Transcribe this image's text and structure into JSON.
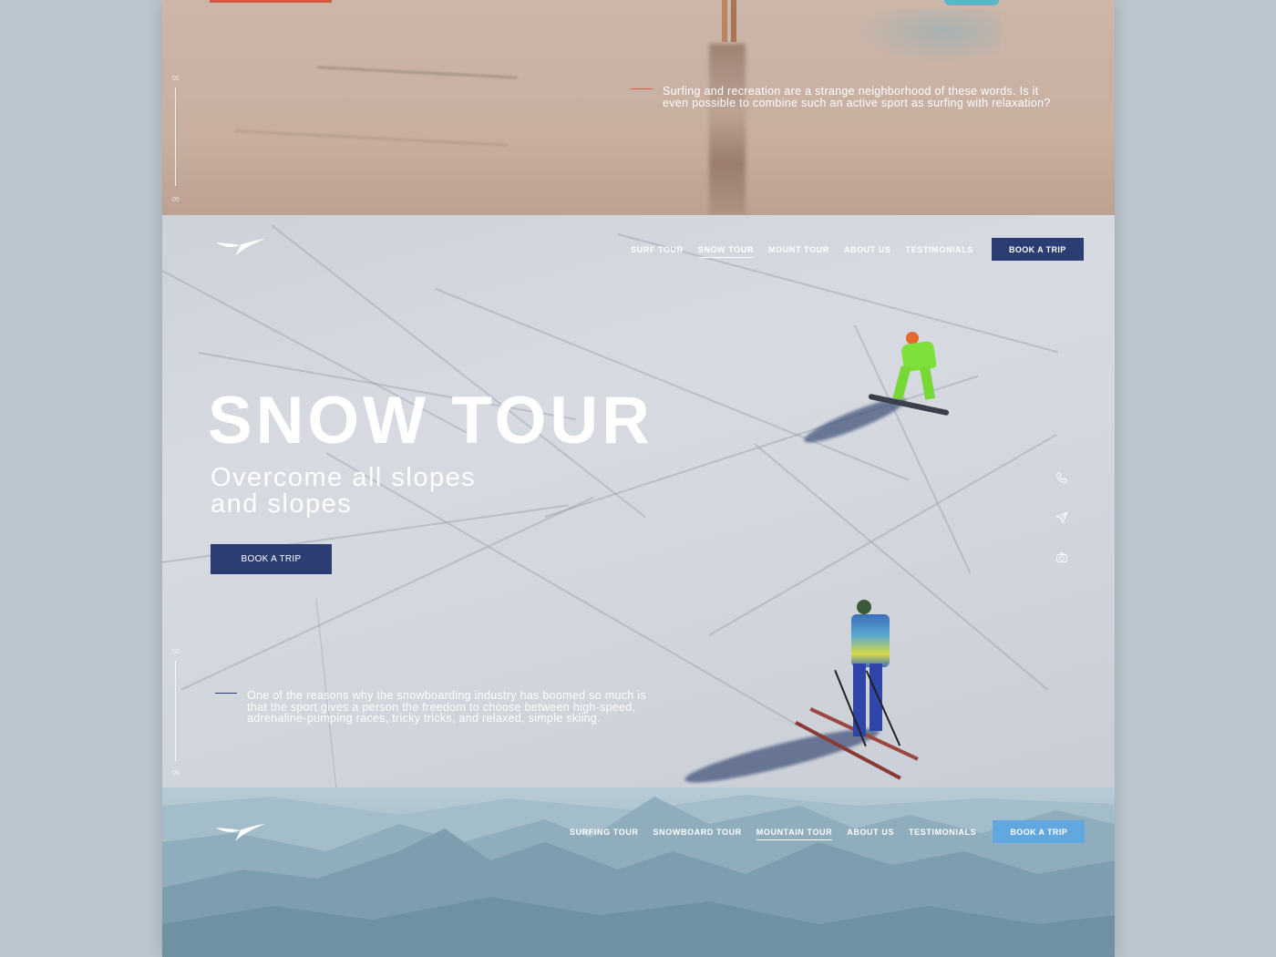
{
  "surf": {
    "index_top": "01",
    "index_bottom": "05",
    "description": "Surfing and recreation are a strange neighborhood of these words. Is it even possible to combine such an active sport as surfing with relaxation?"
  },
  "snow": {
    "nav": [
      "SURF TOUR",
      "SNOW TOUR",
      "MOUNT TOUR",
      "ABOUT US",
      "TESTIMONIALS"
    ],
    "nav_active": "SNOW TOUR",
    "nav_button": "BOOK A TRIP",
    "title": "SNOW TOUR",
    "subtitle_line1": "Overcome all slopes",
    "subtitle_line2": "and slopes",
    "cta": "BOOK A TRIP",
    "index_top": "02",
    "index_bottom": "05",
    "description": "One of the reasons why the snowboarding industry has boomed so much is that the sport gives a person the freedom to choose between high-speed, adrenaline-pumping races, tricky tricks, and relaxed, simple skiing.",
    "social_icons": [
      "phone-icon",
      "send-icon",
      "instagram-icon"
    ]
  },
  "mountain": {
    "nav": [
      "SURFING TOUR",
      "SNOWBOARD TOUR",
      "MOUNTAIN TOUR",
      "ABOUT US",
      "TESTIMONIALS"
    ],
    "nav_active": "MOUNTAIN TOUR",
    "nav_button": "BOOK A TRIP"
  },
  "colors": {
    "page_bg": "#bcc6cf",
    "surf_accent": "#d55b43",
    "snow_accent": "#2b3d72",
    "mountain_accent": "#62a8e0"
  }
}
